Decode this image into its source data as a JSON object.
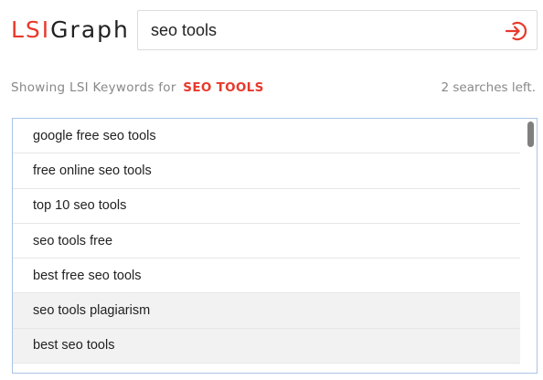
{
  "logo": {
    "part1": "LSI",
    "part2": "Graph"
  },
  "search": {
    "value": "seo tools",
    "submit_icon": "sign-in-arrow-icon"
  },
  "status": {
    "showing_prefix": "Showing LSI Keywords for",
    "keyword": "seo tools",
    "searches_left": "2 searches left."
  },
  "results": [
    "google free seo tools",
    "free online seo tools",
    "top 10 seo tools",
    "seo tools free",
    "best free seo tools",
    "seo tools plagiarism",
    "best seo tools"
  ],
  "colors": {
    "accent": "#e8392b",
    "muted": "#888888",
    "border": "#a9c4e6"
  }
}
